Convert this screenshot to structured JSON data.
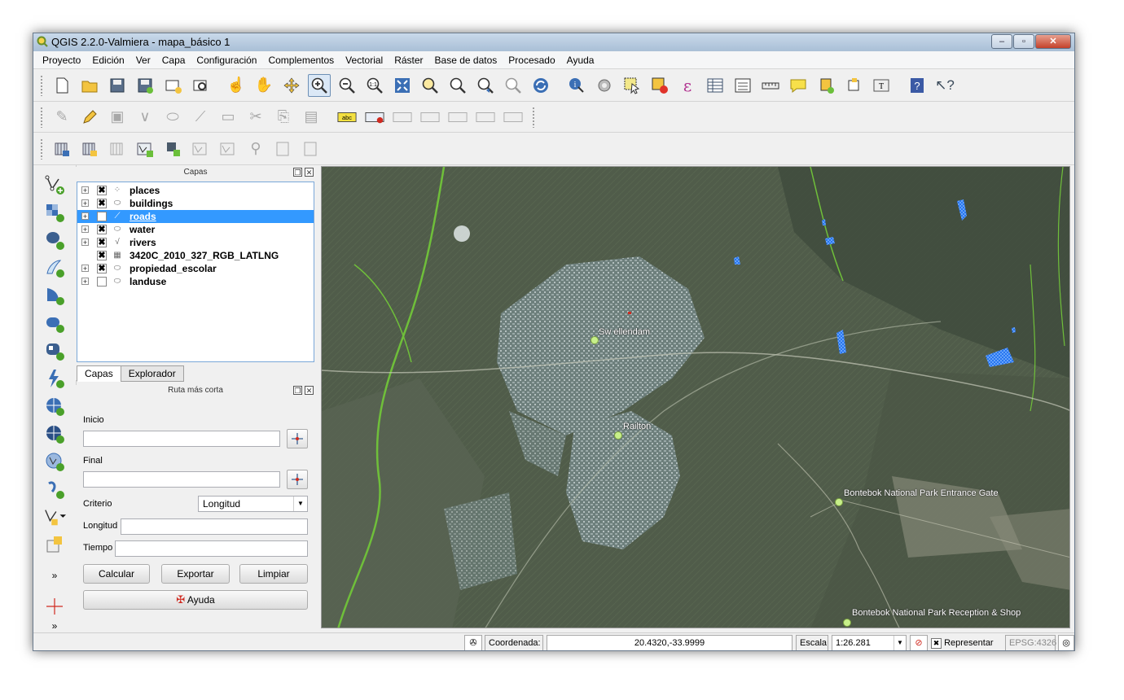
{
  "window": {
    "title": "QGIS 2.2.0-Valmiera - mapa_básico 1",
    "minimize_glyph": "–",
    "maximize_glyph": "▫",
    "close_glyph": "✕"
  },
  "menu": [
    "Proyecto",
    "Edición",
    "Ver",
    "Capa",
    "Configuración",
    "Complementos",
    "Vectorial",
    "Ráster",
    "Base de datos",
    "Procesado",
    "Ayuda"
  ],
  "layers_panel": {
    "title": "Capas",
    "layers": [
      {
        "name": "places",
        "checked": true,
        "icon": "point-layer-icon"
      },
      {
        "name": "buildings",
        "checked": true,
        "icon": "polygon-layer-icon"
      },
      {
        "name": "roads",
        "checked": false,
        "icon": "line-layer-icon",
        "selected": true
      },
      {
        "name": "water",
        "checked": true,
        "icon": "polygon-layer-icon"
      },
      {
        "name": "rivers",
        "checked": true,
        "icon": "line-layer-icon"
      },
      {
        "name": "3420C_2010_327_RGB_LATLNG",
        "checked": true,
        "icon": "raster-layer-icon"
      },
      {
        "name": "propiedad_escolar",
        "checked": true,
        "icon": "polygon-layer-icon"
      },
      {
        "name": "landuse",
        "checked": false,
        "icon": "polygon-layer-icon"
      }
    ],
    "tabs": [
      "Capas",
      "Explorador"
    ]
  },
  "route_panel": {
    "title": "Ruta más corta",
    "start_label": "Inicio",
    "start_value": "",
    "end_label": "Final",
    "end_value": "",
    "criteria_label": "Criterio",
    "criteria_value": "Longitud",
    "length_label": "Longitud",
    "length_value": "",
    "time_label": "Tiempo",
    "time_value": "",
    "calc_button": "Calcular",
    "export_button": "Exportar",
    "clear_button": "Limpiar",
    "help_button": "Ayuda"
  },
  "map": {
    "places": [
      {
        "name": "Sw ellendam"
      },
      {
        "name": "Railton"
      },
      {
        "name": "Bontebok National Park Entrance Gate"
      },
      {
        "name": "Bontebok National Park Reception & Shop"
      }
    ],
    "colors": {
      "place_marker": "#c8f08a",
      "water": "#1e6ff0",
      "river": "#6fbf3a"
    }
  },
  "status": {
    "coord_label": "Coordenada:",
    "coord_value": "20.4320,-33.9999",
    "scale_label": "Escala",
    "scale_value": "1:26.281",
    "render_label": "Representar",
    "render_checked": true,
    "crs": "EPSG:4326"
  },
  "toolbar_labels": {
    "abc": "abc",
    "help_question": "?"
  }
}
